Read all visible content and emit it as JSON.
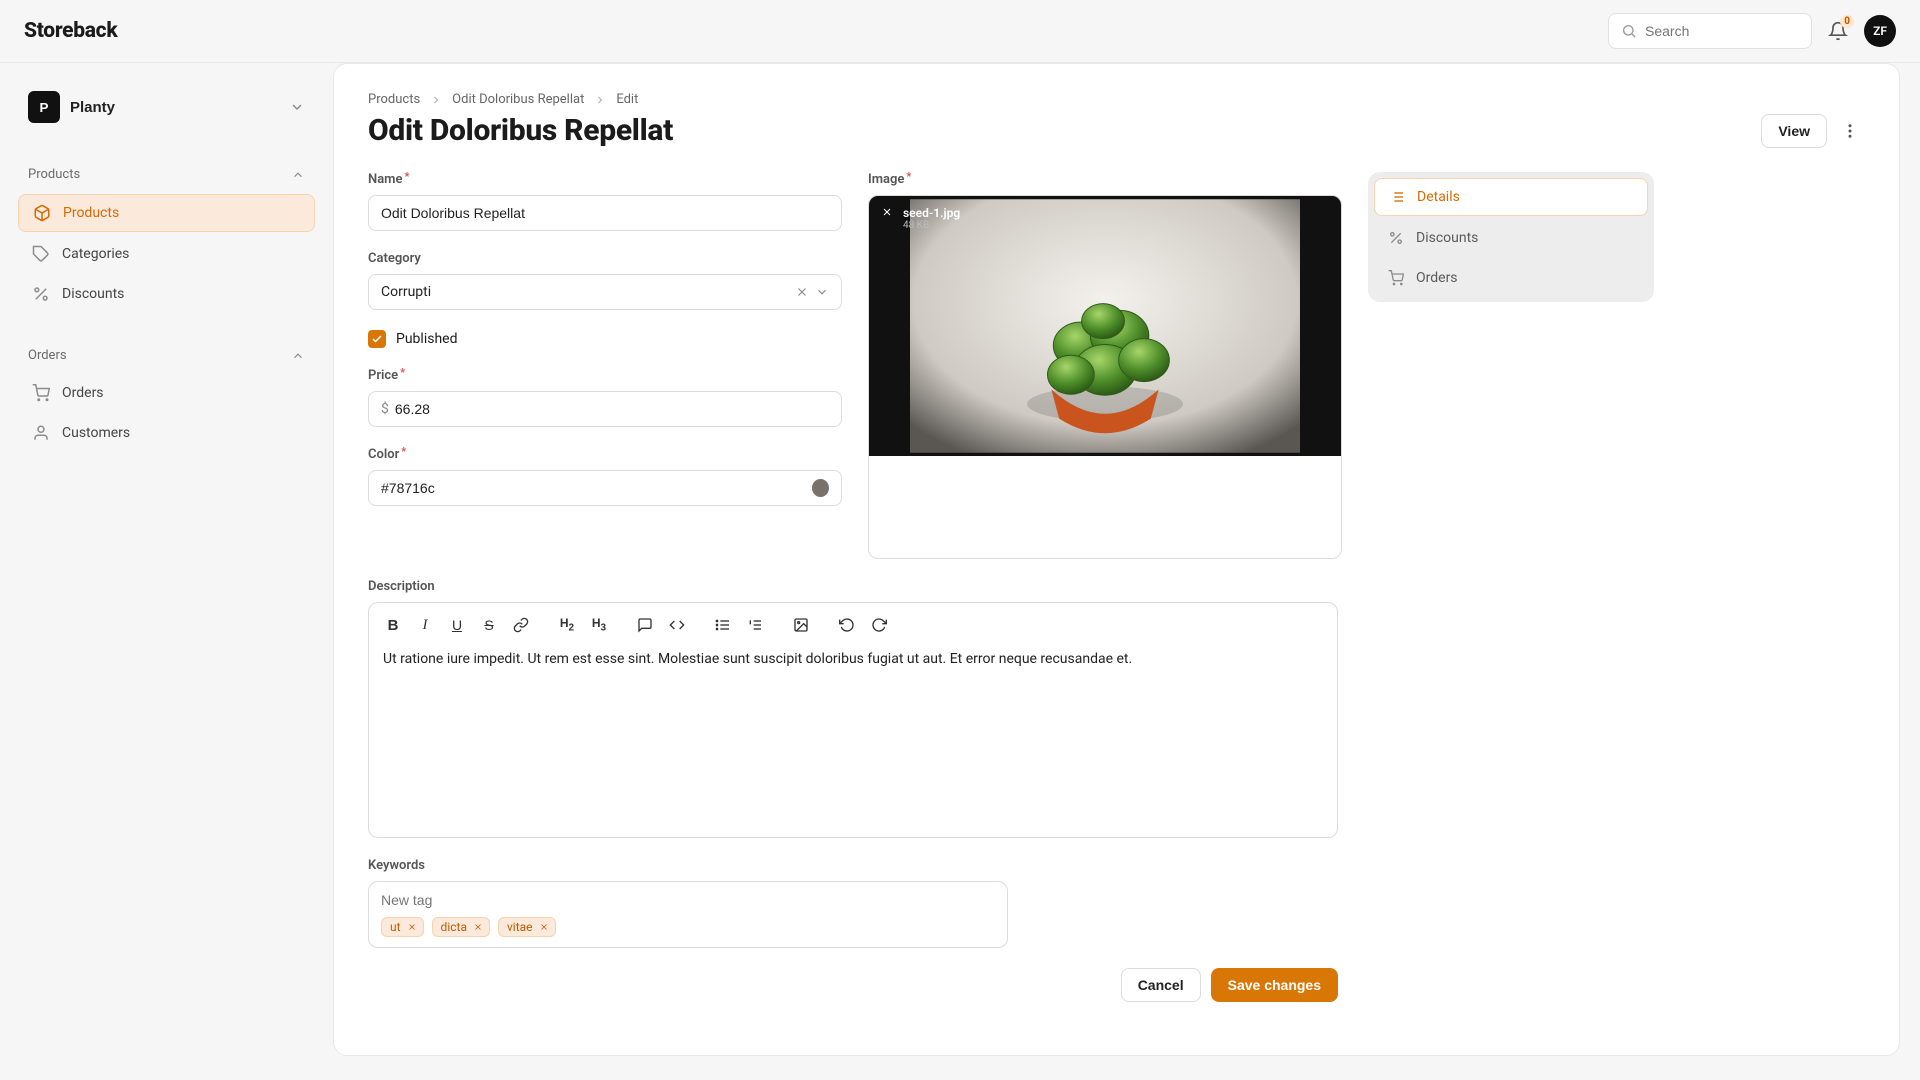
{
  "brand": "Storeback",
  "search": {
    "placeholder": "Search"
  },
  "notifications": {
    "count": "0"
  },
  "user": {
    "initials": "ZF"
  },
  "workspace": {
    "initial": "P",
    "name": "Planty"
  },
  "sidebar": {
    "sections": [
      {
        "label": "Products",
        "items": [
          {
            "label": "Products",
            "icon": "package"
          },
          {
            "label": "Categories",
            "icon": "tag"
          },
          {
            "label": "Discounts",
            "icon": "percent"
          }
        ]
      },
      {
        "label": "Orders",
        "items": [
          {
            "label": "Orders",
            "icon": "cart"
          },
          {
            "label": "Customers",
            "icon": "user"
          }
        ]
      }
    ]
  },
  "breadcrumb": [
    "Products",
    "Odit Doloribus Repellat",
    "Edit"
  ],
  "page": {
    "title": "Odit Doloribus Repellat",
    "view_label": "View"
  },
  "form": {
    "name": {
      "label": "Name",
      "value": "Odit Doloribus Repellat"
    },
    "category": {
      "label": "Category",
      "value": "Corrupti"
    },
    "published": {
      "label": "Published",
      "checked": true
    },
    "price": {
      "label": "Price",
      "currency": "$",
      "value": "66.28"
    },
    "color": {
      "label": "Color",
      "value": "#78716c",
      "swatch": "#78716c"
    },
    "image": {
      "label": "Image",
      "filename": "seed-1.jpg",
      "size": "48 KB"
    },
    "description": {
      "label": "Description",
      "text": "Ut ratione iure impedit. Ut rem est esse sint. Molestiae sunt suscipit doloribus fugiat ut aut. Et error neque recusandae et."
    },
    "keywords": {
      "label": "Keywords",
      "placeholder": "New tag",
      "tags": [
        "ut",
        "dicta",
        "vitae"
      ]
    }
  },
  "side_tabs": [
    {
      "label": "Details",
      "icon": "list"
    },
    {
      "label": "Discounts",
      "icon": "percent"
    },
    {
      "label": "Orders",
      "icon": "cart"
    }
  ],
  "footer": {
    "cancel": "Cancel",
    "save": "Save changes"
  }
}
